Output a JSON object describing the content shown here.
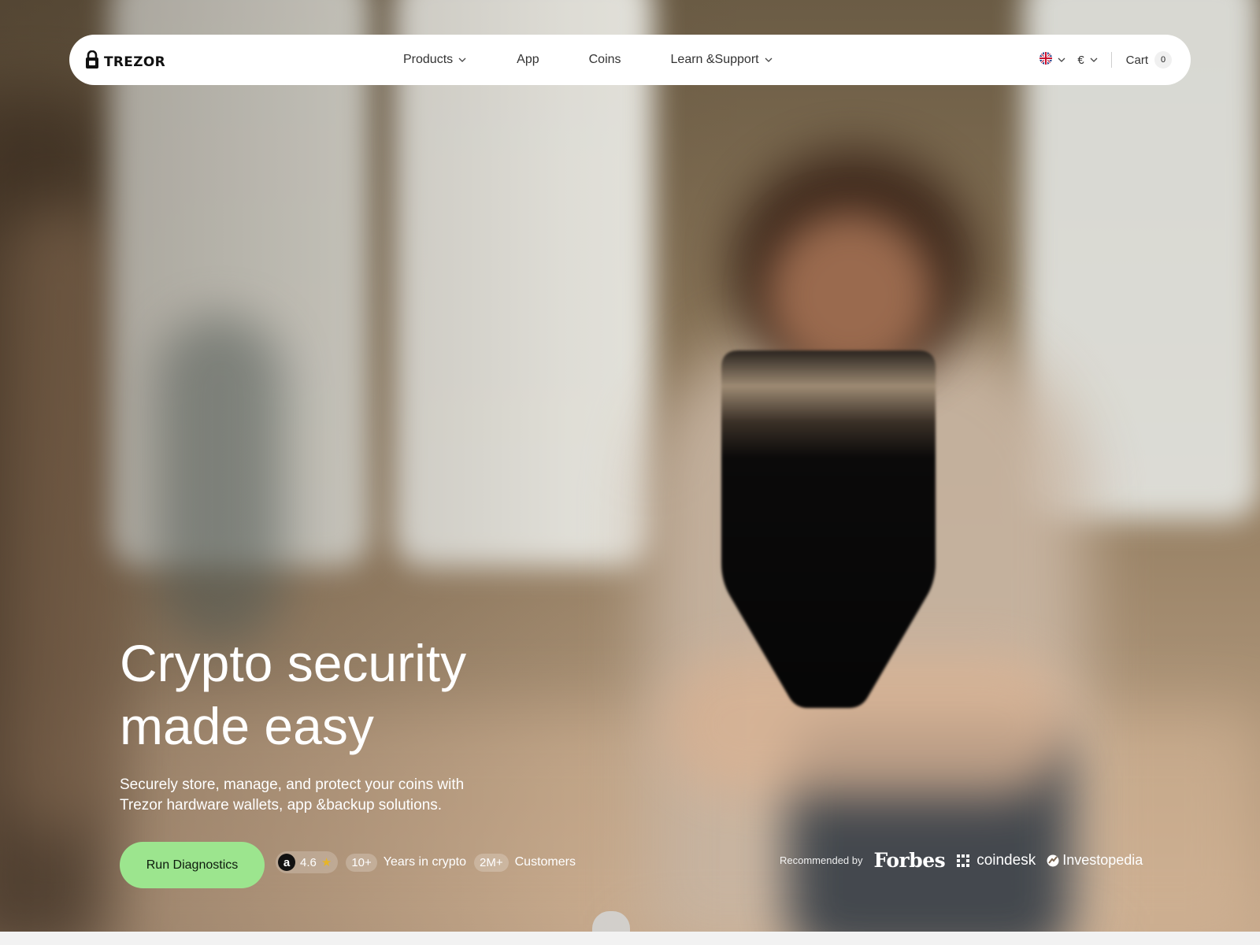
{
  "nav": {
    "brand": "TREZOR",
    "menu": [
      {
        "label": "Products",
        "has_dropdown": true
      },
      {
        "label": "App",
        "has_dropdown": false
      },
      {
        "label": "Coins",
        "has_dropdown": false
      },
      {
        "label": "Learn &Support",
        "has_dropdown": true
      }
    ],
    "language_icon": "uk-flag-icon",
    "currency": "€",
    "cart_label": "Cart",
    "cart_count": "0"
  },
  "hero": {
    "headline_line1": "Crypto security",
    "headline_line2": "made easy",
    "subline_line1": "Securely store, manage, and protect your coins with",
    "subline_line2": "Trezor hardware wallets, app &backup solutions.",
    "cta_label": "Run Diagnostics",
    "rating": {
      "source_icon": "amazon-icon",
      "source_glyph": "a",
      "value": "4.6",
      "star": "★"
    },
    "stats": [
      {
        "num": "10+",
        "label": "Years in crypto"
      },
      {
        "num": "2M+",
        "label": "Customers"
      }
    ],
    "recommended": {
      "label": "Recommended by",
      "brands": [
        "Forbes",
        "coindesk",
        "Investopedia"
      ]
    }
  },
  "colors": {
    "cta_bg": "#9ce58e",
    "nav_bg": "#ffffff",
    "star": "#e7b526"
  }
}
